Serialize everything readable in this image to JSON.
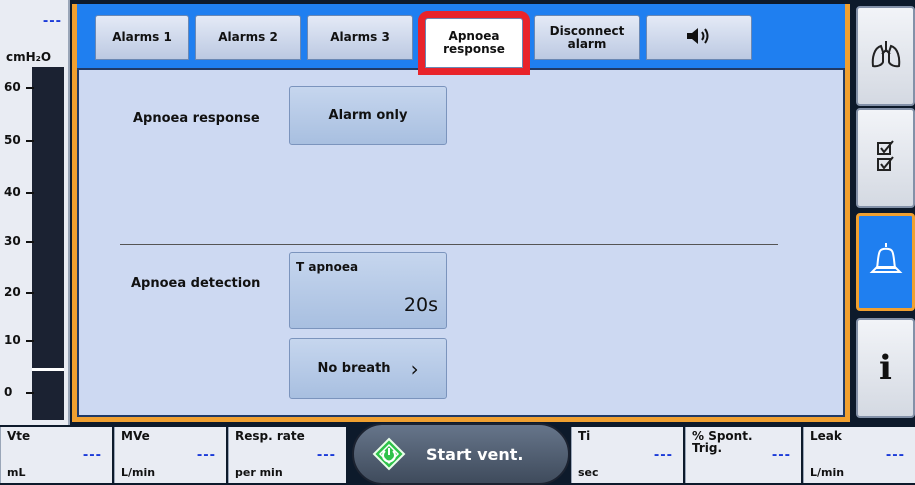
{
  "gauge": {
    "value": "---",
    "unit": "cmH₂O",
    "ticks": [
      "60",
      "50",
      "40",
      "30",
      "20",
      "10",
      "0"
    ]
  },
  "tabs": {
    "alarms1": "Alarms 1",
    "alarms2": "Alarms 2",
    "alarms3": "Alarms 3",
    "apnoea_response_line1": "Apnoea",
    "apnoea_response_line2": "response",
    "disconnect_line1": "Disconnect",
    "disconnect_line2": "alarm",
    "sound_icon": "speaker-icon",
    "active_tab": "Apnoea response"
  },
  "panel": {
    "apnoea_response_label": "Apnoea response",
    "apnoea_response_value": "Alarm only",
    "apnoea_detection_label": "Apnoea detection",
    "t_apnoea_label": "T apnoea",
    "t_apnoea_value": "20s",
    "no_breath_label": "No breath",
    "no_breath_chevron": "›"
  },
  "right_nav": {
    "items": [
      "lungs-icon",
      "checklist-icon",
      "bell-icon",
      "info-icon"
    ],
    "active": "bell-icon",
    "info_glyph": "i"
  },
  "measurements": [
    {
      "name": "Vte",
      "value": "---",
      "unit": "mL"
    },
    {
      "name": "MVe",
      "value": "---",
      "unit": "L/min"
    },
    {
      "name": "Resp. rate",
      "value": "---",
      "unit": "per min"
    },
    {
      "name": "Ti",
      "value": "---",
      "unit": "sec"
    },
    {
      "name": "% Spont.",
      "name2": "Trig.",
      "value": "---",
      "unit": ""
    },
    {
      "name": "Leak",
      "value": "---",
      "unit": "L/min"
    }
  ],
  "start_button": {
    "label": "Start vent."
  },
  "colors": {
    "accent_blue": "#1f7ff0",
    "panel_bg": "#cdd9f2",
    "frame_orange": "#f0a030",
    "highlight_red": "#e8232b",
    "value_blue": "#1a3ad8",
    "start_icon_green": "#2fc24a"
  }
}
